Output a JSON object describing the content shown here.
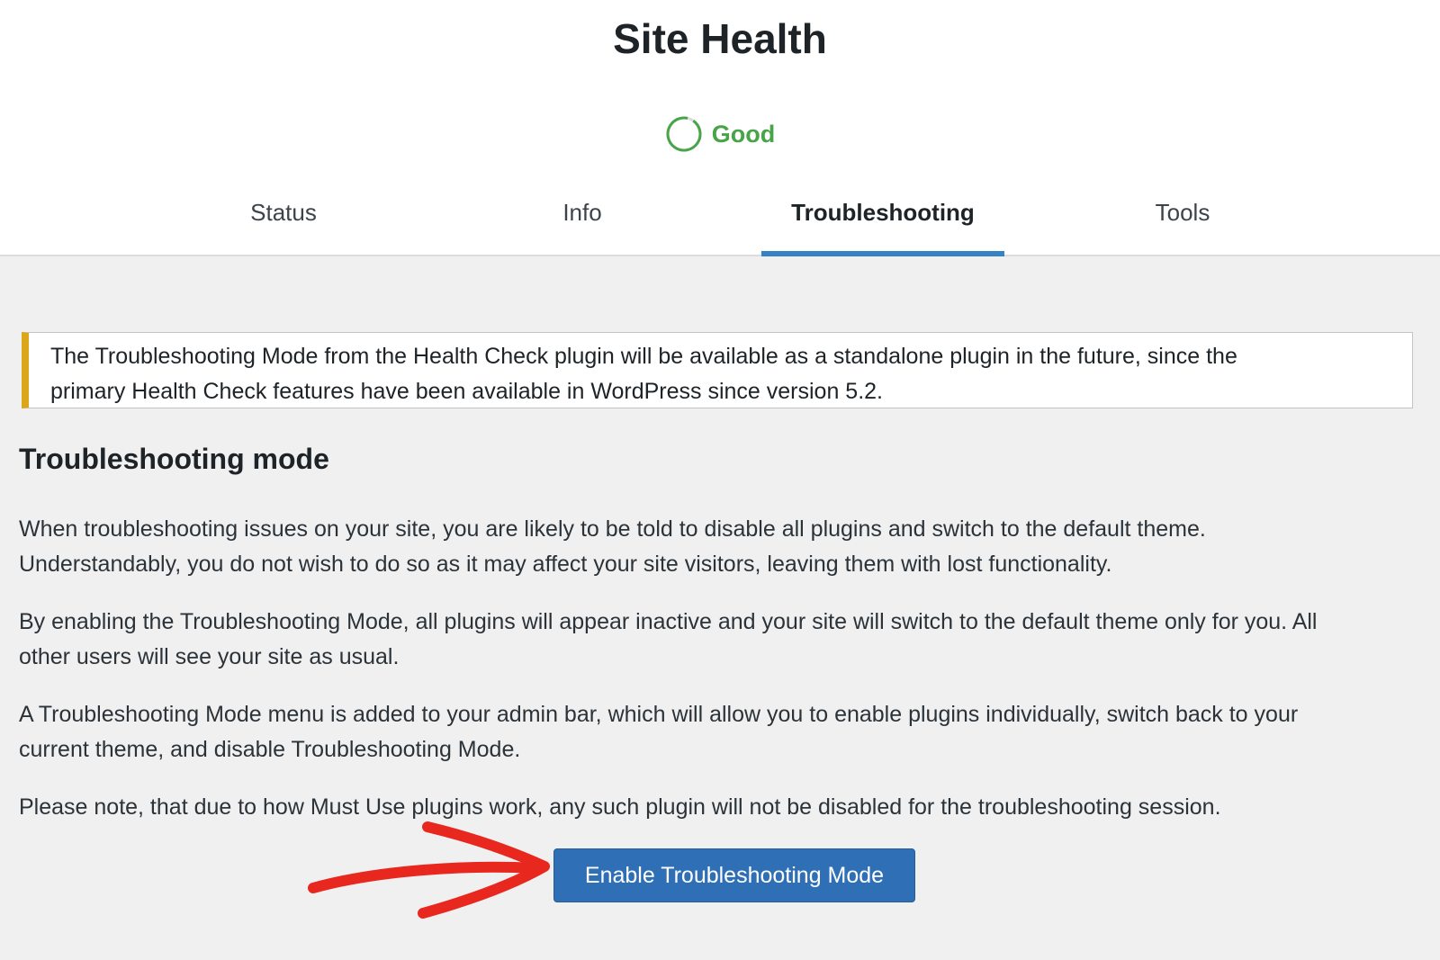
{
  "header": {
    "title": "Site Health",
    "status": {
      "label": "Good",
      "color": "#47a447",
      "icon": "progress-ring-icon"
    }
  },
  "tabs": [
    {
      "label": "Status",
      "active": false
    },
    {
      "label": "Info",
      "active": false
    },
    {
      "label": "Troubleshooting",
      "active": true
    },
    {
      "label": "Tools",
      "active": false
    }
  ],
  "notice": {
    "line1": "The Troubleshooting Mode from the Health Check plugin will be available as a standalone plugin in the future, since the",
    "line2": "primary Health Check features have been available in WordPress since version 5.2."
  },
  "section": {
    "title": "Troubleshooting mode",
    "paragraphs": [
      {
        "line1": "When troubleshooting issues on your site, you are likely to be told to disable all plugins and switch to the default theme.",
        "line2": "Understandably, you do not wish to do so as it may affect your site visitors, leaving them with lost functionality."
      },
      {
        "line1": "By enabling the Troubleshooting Mode, all plugins will appear inactive and your site will switch to the default theme only for you. All",
        "line2": "other users will see your site as usual."
      },
      {
        "line1": "A Troubleshooting Mode menu is added to your admin bar, which will allow you to enable plugins individually, switch back to your",
        "line2": "current theme, and disable Troubleshooting Mode."
      },
      {
        "line1": "Please note, that due to how Must Use plugins work, any such plugin will not be disabled for the troubleshooting session."
      }
    ],
    "button_label": "Enable Troubleshooting Mode"
  },
  "colors": {
    "accent": "#3582c4",
    "button": "#2f6fb6",
    "notice_border": "#dba617",
    "annotation_arrow": "#e8281e"
  }
}
